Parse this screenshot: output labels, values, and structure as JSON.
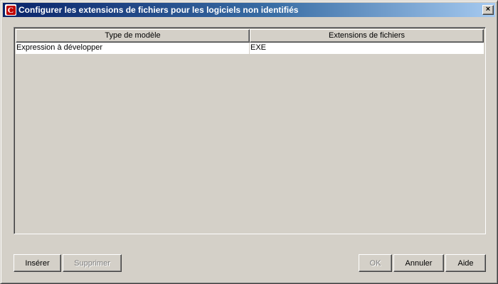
{
  "window": {
    "title": "Configurer les extensions de fichiers pour les logiciels non identifiés",
    "close_label": "×"
  },
  "table": {
    "columns": [
      "Type de modèle",
      "Extensions de fichiers"
    ],
    "rows": [
      [
        "Expression à développer",
        "EXE"
      ]
    ]
  },
  "buttons": {
    "insert": "Insérer",
    "delete": "Supprimer",
    "ok": "OK",
    "cancel": "Annuler",
    "help": "Aide"
  },
  "colors": {
    "titlebar_start": "#0a246a",
    "titlebar_end": "#a6caf0",
    "face": "#d4d0c8",
    "icon_red": "#c00000"
  },
  "icons": {
    "app": "app-c-logo-icon",
    "close": "close-icon"
  }
}
